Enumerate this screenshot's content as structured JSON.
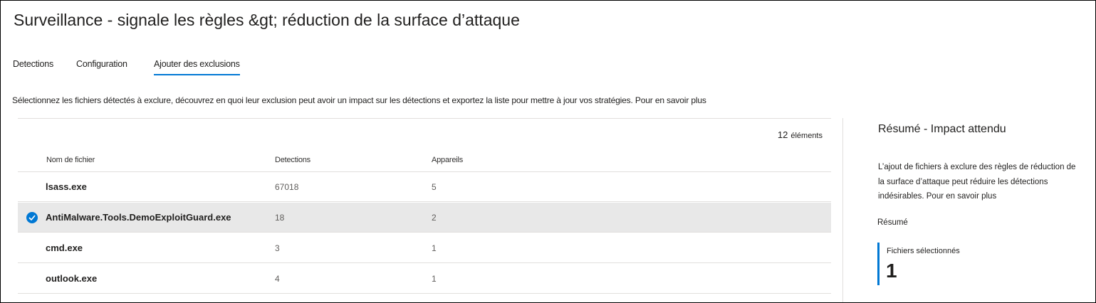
{
  "header": {
    "title": "Surveillance - signale les règles &gt; réduction de la surface d’attaque"
  },
  "tabs": [
    {
      "label": "Detections",
      "active": false
    },
    {
      "label": "Configuration",
      "active": false
    },
    {
      "label": "Ajouter des exclusions",
      "active": true
    }
  ],
  "description": {
    "text": "Sélectionnez les fichiers détectés à exclure, découvrez en quoi leur exclusion peut avoir un impact sur les détections et exportez la liste pour mettre à jour vos stratégies.",
    "link": "Pour en savoir plus"
  },
  "table": {
    "count": "12",
    "count_label": "éléments",
    "columns": [
      "Nom de fichier",
      "Detections",
      "Appareils"
    ],
    "rows": [
      {
        "name": "lsass.exe",
        "detections": "67018",
        "devices": "5",
        "selected": false
      },
      {
        "name": "AntiMalware.Tools.DemoExploitGuard.exe",
        "detections": "18",
        "devices": "2",
        "selected": true
      },
      {
        "name": "cmd.exe",
        "detections": "3",
        "devices": "1",
        "selected": false
      },
      {
        "name": "outlook.exe",
        "detections": "4",
        "devices": "1",
        "selected": false
      }
    ]
  },
  "summary": {
    "title": "Résumé - Impact attendu",
    "text_lines": [
      "L’ajout de fichiers à exclure des règles de réduction de",
      "la surface d’attaque peut réduire les détections",
      "indésirables. Pour en savoir plus"
    ],
    "section_label": "Résumé",
    "kpi_label": "Fichiers sélectionnés",
    "kpi_value": "1"
  },
  "colors": {
    "accent": "#0078d4",
    "selected_row": "#e8e8e8",
    "divider": "#e1dfdd"
  },
  "icons": {
    "selected_row": "checkmark-circle-icon"
  }
}
